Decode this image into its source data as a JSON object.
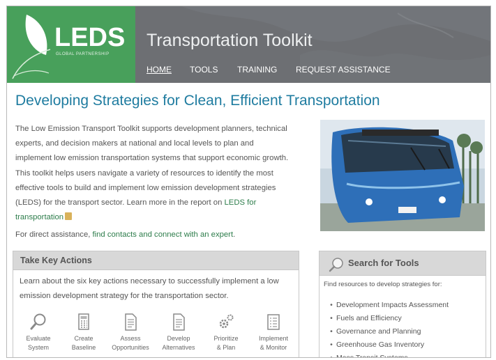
{
  "header": {
    "logo_text": "LEDS",
    "logo_subtitle": "GLOBAL PARTNERSHIP",
    "site_title": "Transportation Toolkit",
    "nav": [
      {
        "label": "HOME",
        "active": true
      },
      {
        "label": "TOOLS",
        "active": false
      },
      {
        "label": "TRAINING",
        "active": false
      },
      {
        "label": "REQUEST ASSISTANCE",
        "active": false
      }
    ]
  },
  "main": {
    "title": "Developing Strategies for Clean, Efficient Transportation",
    "intro_text": "The Low Emission Transport Toolkit supports development planners, technical experts, and decision makers at national and local levels to plan and implement low emission transportation systems that support economic growth. This toolkit helps users navigate a variety of resources to identify the most effective tools to build and implement low emission development strategies (LEDS) for the transport sector. Learn more in the report on ",
    "intro_link": "LEDS for transportation",
    "assist_prefix": "For direct assistance, ",
    "assist_link": "find contacts and connect with an expert",
    "assist_suffix": "."
  },
  "key_actions": {
    "title": "Take Key Actions",
    "description": "Learn about the six key actions necessary to successfully implement a low emission development strategy for the transportation sector.",
    "items": [
      {
        "line1": "Evaluate",
        "line2": "System",
        "icon": "magnifier-icon"
      },
      {
        "line1": "Create",
        "line2": "Baseline",
        "icon": "calculator-icon"
      },
      {
        "line1": "Assess",
        "line2": "Opportunities",
        "icon": "document-icon"
      },
      {
        "line1": "Develop",
        "line2": "Alternatives",
        "icon": "document-icon"
      },
      {
        "line1": "Prioritize",
        "line2": "& Plan",
        "icon": "gears-icon"
      },
      {
        "line1": "Implement",
        "line2": "& Monitor",
        "icon": "checklist-icon"
      }
    ]
  },
  "search": {
    "title": "Search for Tools",
    "description": "Find resources to develop strategies for:",
    "items": [
      "Development Impacts Assessment",
      "Fuels and Efficiency",
      "Governance and Planning",
      "Greenhouse Gas Inventory",
      "Mass Transit Systems"
    ]
  },
  "colors": {
    "header_gray": "#6d6f73",
    "logo_green": "#48a05b",
    "title_blue": "#1f7ca0",
    "link_green": "#2c7c4a",
    "panel_gray": "#d8d8d8"
  }
}
